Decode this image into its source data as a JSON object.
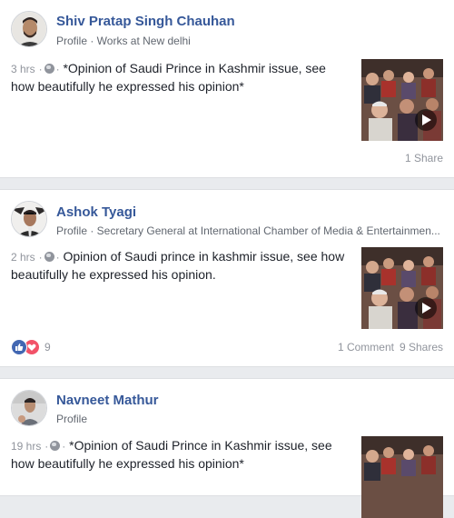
{
  "posts": [
    {
      "name": "Shiv Pratap Singh Chauhan",
      "subtitle": "Profile · Works at New delhi",
      "time": "3 hrs",
      "dot": "·",
      "text": "*Opinion of Saudi Prince in Kashmir issue, see how beautifully he expressed his opinion*",
      "shares": "1 Share"
    },
    {
      "name": "Ashok Tyagi",
      "subtitle": "Profile · Secretary General at International Chamber of Media & Entertainmen...",
      "time": "2 hrs",
      "dot": "·",
      "text": "Opinion of Saudi prince in kashmir issue, see how beautifully he expressed his opinion.",
      "reaction_count": "9",
      "comments": "1 Comment",
      "shares": "9 Shares"
    },
    {
      "name": "Navneet Mathur",
      "subtitle": "Profile",
      "time": "19 hrs",
      "dot": "·",
      "text": "*Opinion of Saudi Prince in Kashmir issue, see how beautifully he expressed his opinion*"
    }
  ],
  "icons": {
    "privacy": "globe-icon",
    "play": "play-icon",
    "like": "like-reaction-icon",
    "love": "love-reaction-icon"
  },
  "colors": {
    "name": "#365899",
    "meta": "#90949c",
    "like": "#4267b2",
    "love": "#f25268"
  }
}
